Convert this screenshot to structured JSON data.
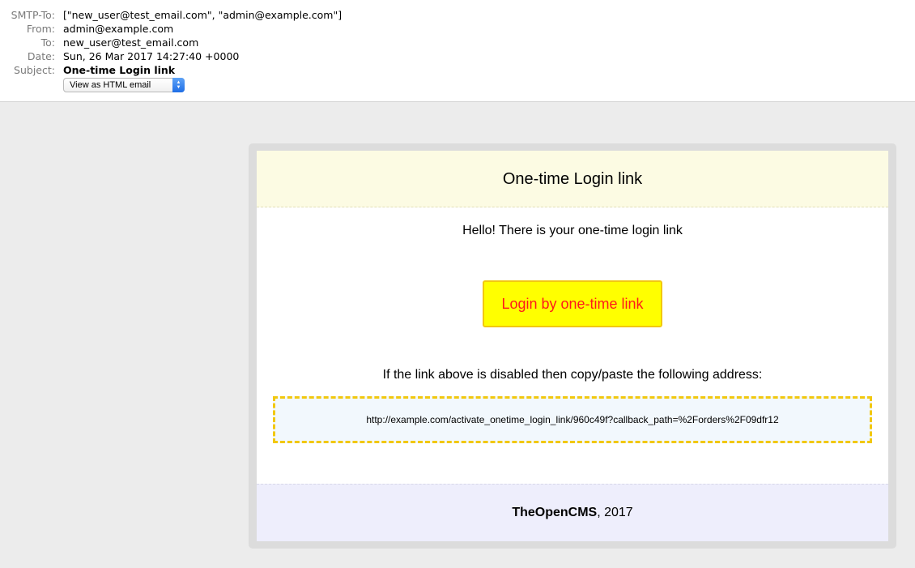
{
  "headers": {
    "smtp_to": {
      "label": "SMTP-To:",
      "value": "[\"new_user@test_email.com\", \"admin@example.com\"]"
    },
    "from": {
      "label": "From:",
      "value": "admin@example.com"
    },
    "to": {
      "label": "To:",
      "value": "new_user@test_email.com"
    },
    "date": {
      "label": "Date:",
      "value": "Sun, 26 Mar 2017 14:27:40 +0000"
    },
    "subject": {
      "label": "Subject:",
      "value": "One-time Login link"
    },
    "view_select": {
      "selected": "View as HTML email"
    }
  },
  "email": {
    "title": "One-time Login link",
    "greeting": "Hello! There is your one-time login link",
    "button_label": "Login by one-time link",
    "copy_instruction": "If the link above is disabled then copy/paste the following address:",
    "url": "http://example.com/activate_onetime_login_link/960c49f?callback_path=%2Forders%2F09dfr12",
    "footer": {
      "brand": "TheOpenCMS",
      "suffix": ", 2017"
    }
  },
  "colors": {
    "header_bg": "#fcfbe3",
    "button_bg": "#ffff00",
    "button_text": "#ff1a1a",
    "dashed_border": "#f2c80f",
    "url_bg": "#f2f8fd",
    "footer_bg": "#eeeefc"
  }
}
